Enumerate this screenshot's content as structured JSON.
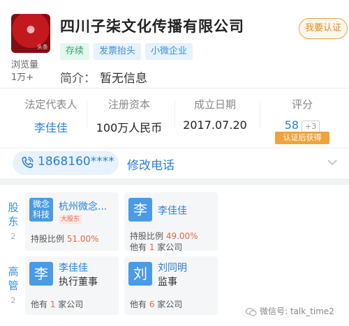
{
  "company": {
    "avatar_icon": "company-logo-icon",
    "avatar_watermark": "头条",
    "name": "四川子柒文化传播有限公司",
    "views_label": "浏览量",
    "views_count": "1万+",
    "verify_button": "我要认证",
    "tags": [
      "存续",
      "发票抬头",
      "小微企业"
    ],
    "intro_label": "简介：",
    "intro_value": "暂无信息"
  },
  "stats": {
    "legal_rep": {
      "label": "法定代表人",
      "value": "李佳佳"
    },
    "capital": {
      "label": "注册资本",
      "value": "100万人民币"
    },
    "founded": {
      "label": "成立日期",
      "value": "2017.07.20"
    },
    "score": {
      "label": "评分",
      "value": "58",
      "plus": "+3",
      "badge": "认证后获得"
    }
  },
  "phone": {
    "icon": "phone-icon",
    "number": "1868160****",
    "edit_label": "修改电话",
    "expand_icon": "chevron-down-icon"
  },
  "shareholders": {
    "label": "股东",
    "count": "2",
    "items": [
      {
        "icon_text": "微念科技",
        "name": "杭州微念...",
        "badge": "大股东",
        "line_prefix": "持股比例 ",
        "line_value": "51.00%",
        "line_suffix": ""
      },
      {
        "icon_text": "李",
        "name": "李佳佳",
        "badge": "",
        "line_prefix": "持股比例 ",
        "line_value": "49.00%",
        "line2_prefix": "他有 ",
        "line2_value": "1",
        "line2_suffix": " 家公司"
      }
    ]
  },
  "executives": {
    "label": "高管",
    "count": "2",
    "items": [
      {
        "icon_text": "李",
        "name": "李佳佳",
        "role": "执行董事",
        "line_prefix": "他有 ",
        "line_value": "1",
        "line_suffix": " 家公司"
      },
      {
        "icon_text": "刘",
        "name": "刘同明",
        "role": "监事",
        "line_prefix": "他有 ",
        "line_value": "6",
        "line_suffix": " 家公司"
      }
    ]
  },
  "watermark": {
    "icon": "wechat-icon",
    "text": "微信号: talk_time2"
  }
}
